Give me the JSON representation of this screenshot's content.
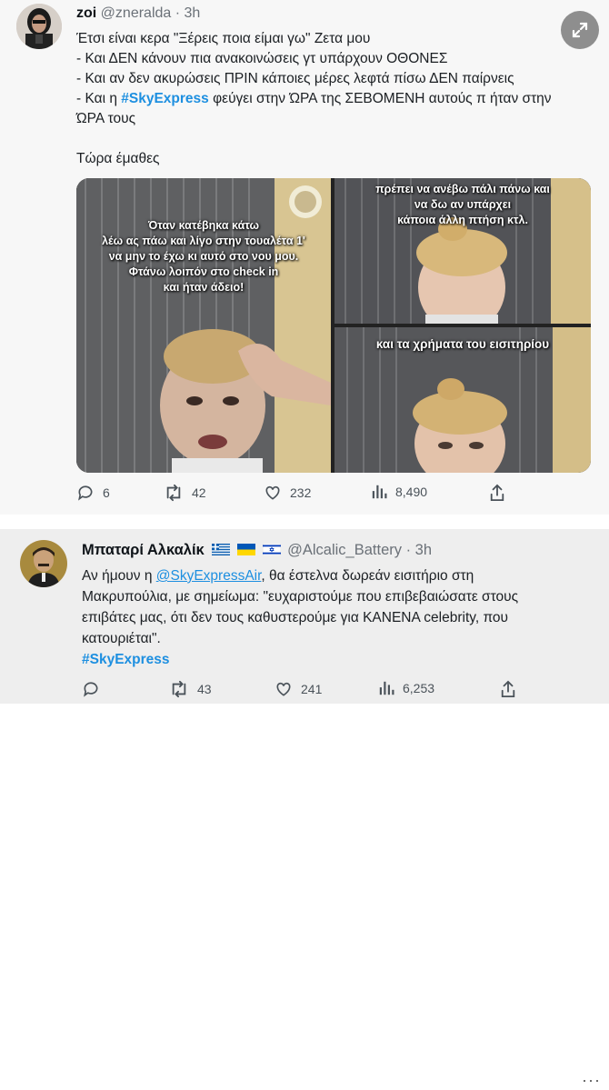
{
  "tweet1": {
    "display_name": "zoi",
    "handle": "@zneralda",
    "time": "· 3h",
    "lines": [
      "Έτσι είναι κερα \"Ξέρεις ποια είμαι γω\" Ζετα μου",
      "- Και ΔΕΝ κάνουν πια ανακοινώσεις γτ υπάρχουν ΟΘΟΝΕΣ",
      "- Και αν δεν ακυρώσεις ΠΡΙΝ κάποιες μέρες λεφτά πίσω ΔΕΝ παίρνεις"
    ],
    "line4_prefix": "- Και η",
    "line4_hashtag": "#SkyExpress",
    "line4_suffix": "φεύγει στην ΏΡΑ της ΣΕΒΟΜΕΝΗ αυτούς π ήταν στην",
    "line5": "ΏΡΑ τους",
    "closing": "Τώρα έμαθες",
    "media": {
      "caption_left": [
        "Όταν κατέβηκα κάτω",
        "λέω ας πάω και λίγο στην τουαλέτα 1'",
        "να μην το έχω κι αυτό στο νου μου.",
        "Φτάνω λοιπόν στο check in",
        "και ήταν άδειο!"
      ],
      "caption_top_right": [
        "πρέπει να ανέβω πάλι πάνω και",
        "να δω αν υπάρχει",
        "κάποια άλλη πτήση κτλ."
      ],
      "caption_bottom_right": "και τα χρήματα του εισιτηρίου"
    },
    "stats": {
      "replies": "6",
      "retweets": "42",
      "likes": "232",
      "views": "8,490"
    }
  },
  "tweet2": {
    "display_name": "Μπαταρί Αλκαλίκ",
    "flags": [
      "greek-flag-icon",
      "ukraine-flag-icon",
      "israel-flag-icon"
    ],
    "handle": "@Alcalic_Battery",
    "time": "· 3h",
    "prefix": "Αν ήμουν η",
    "mention": "@SkyExpressAir",
    "suffix": ", θα έστελνα δωρεάν εισιτήριο στη",
    "lines": [
      "Μακρυπούλια, με σημείωμα: \"ευχαριστούμε που επιβεβαιώσατε στους",
      "επιβάτες μας, ότι δεν τους καθυστερούμε για ΚΑΝΕΝΑ celebrity, που",
      "κατουριέται\"."
    ],
    "hashtag": "#SkyExpress",
    "stats": {
      "retweets": "43",
      "likes": "241",
      "views": "6,253"
    }
  },
  "colors": {
    "link": "#1d8fe0",
    "muted": "#6b7178"
  }
}
